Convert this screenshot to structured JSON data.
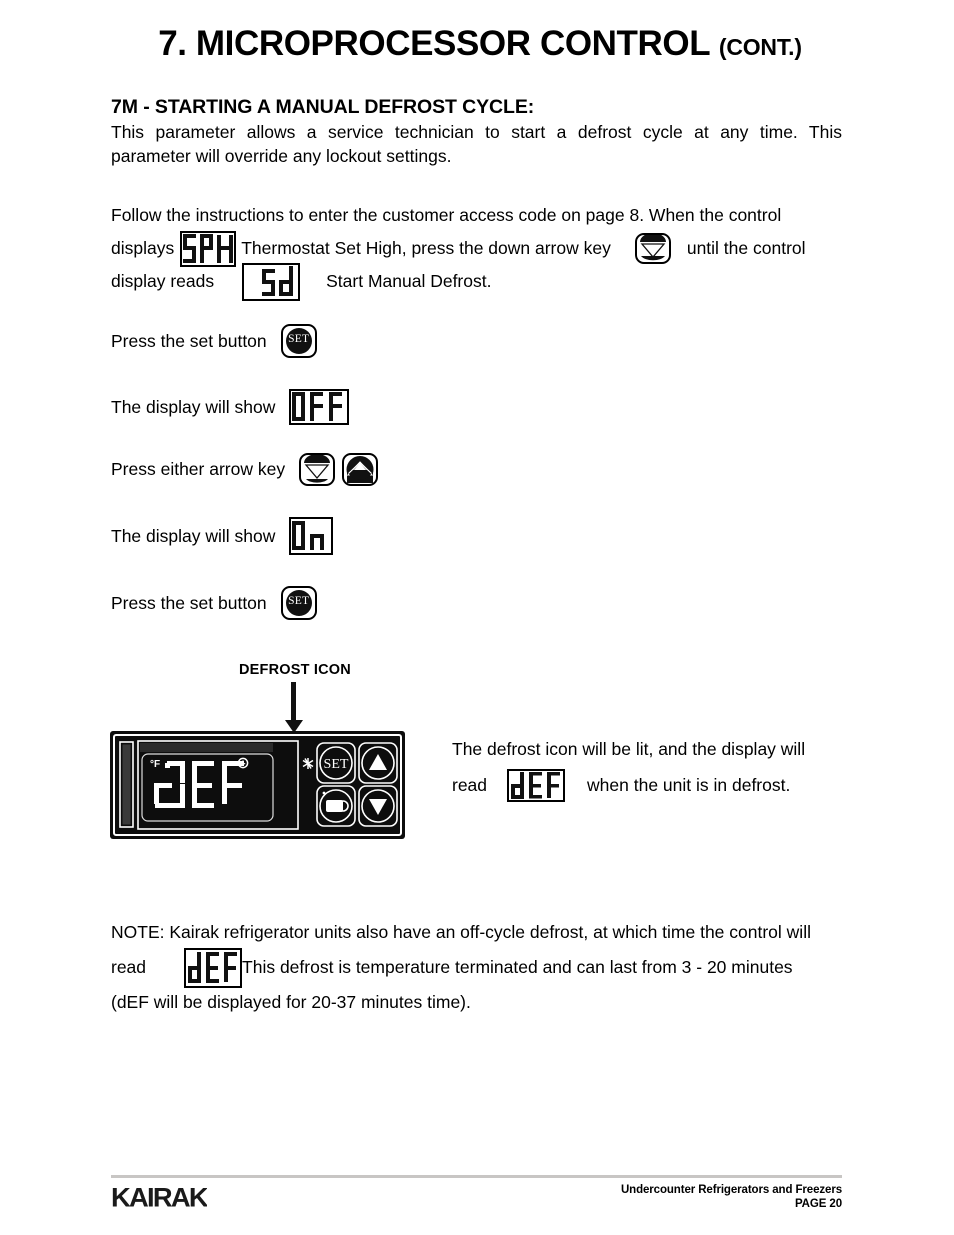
{
  "document": {
    "title_number": "7.",
    "title_main": "MICROPROCESSOR CONTROL",
    "title_suffix": "(CONT.)",
    "section_heading": "7M - STARTING A MANUAL DEFROST CYCLE:"
  },
  "intro": {
    "line1": "This parameter allows a service technician to start a defrost cycle at any time. This",
    "line2": "parameter will override any lockout settings."
  },
  "flow": {
    "line1": "Follow the instructions to enter the customer access code on page 8. When the control",
    "line2_a": "displays",
    "line2_b": "Thermostat Set High, press the down arrow key",
    "line2_c": "until the control",
    "line3_a": "display reads",
    "line3_b": "Start Manual Defrost."
  },
  "steps": [
    {
      "text": "Press the set button",
      "icon": "set-button"
    },
    {
      "text": "The display will show",
      "icon": "lcd-off"
    },
    {
      "text": "Press either arrow key",
      "icon": "arrow-keys"
    },
    {
      "text": "The display will show",
      "icon": "lcd-on"
    },
    {
      "text": "Press the set button",
      "icon": "set-button"
    }
  ],
  "callout": {
    "label": "DEFROST ICON"
  },
  "controller": {
    "display_value": "dEF",
    "unit_label": "°F",
    "clock_icon": "clock-icon",
    "defrost_icon": "snowflake-icon",
    "set_label": "SET",
    "buttons": [
      "set-button",
      "up-arrow-button",
      "light-button",
      "down-arrow-button"
    ]
  },
  "defrost_text": {
    "line1": "The defrost icon will be lit, and the display will",
    "line2_a": "read",
    "line2_b": "when the unit is in defrost."
  },
  "note": {
    "line1": "NOTE: Kairak refrigerator units also have an off-cycle defrost, at which time the control will",
    "line2_a": "read",
    "line2_b": "This defrost is temperature terminated and can last from 3 - 20 minutes",
    "line3": "(dEF will be displayed for 20-37 minutes time)."
  },
  "lcd_values": {
    "sph": "SPH",
    "sd": "Sd",
    "off": "OFF",
    "on": "On",
    "def": "dEF"
  },
  "footer": {
    "brand": "KAIRAK",
    "line1": "Undercounter Refrigerators and Freezers",
    "line2": "PAGE 20"
  },
  "colors": {
    "ink": "#000000",
    "rule": "#c8c6c4",
    "panel": "#111111"
  }
}
